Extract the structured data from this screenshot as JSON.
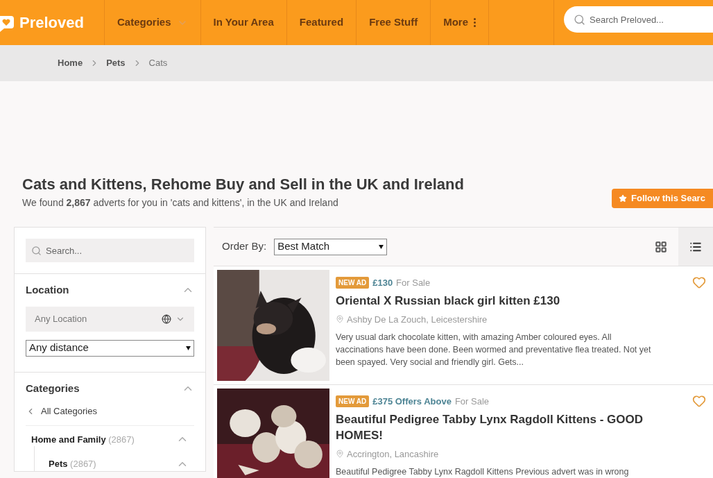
{
  "header": {
    "logo": "Preloved",
    "nav": [
      {
        "label": "Categories",
        "kind": "dropdown"
      },
      {
        "label": "In Your Area",
        "kind": "link"
      },
      {
        "label": "Featured",
        "kind": "link"
      },
      {
        "label": "Free Stuff",
        "kind": "link"
      },
      {
        "label": "More",
        "kind": "more"
      }
    ],
    "search": {
      "placeholder": "Search Preloved..."
    }
  },
  "breadcrumb": [
    {
      "label": "Home",
      "current": false
    },
    {
      "label": "Pets",
      "current": false
    },
    {
      "label": "Cats",
      "current": true
    }
  ],
  "heading": {
    "title": "Cats and Kittens, Rehome Buy and Sell in the UK and Ireland",
    "summary": "We found **2,867** adverts for you in 'cats and kittens', in the UK and Ireland",
    "follow_button": "Follow this Searc"
  },
  "sidebar": {
    "search": {
      "placeholder": "Search..."
    },
    "location": {
      "title": "Location",
      "expanded": true,
      "location_placeholder": "Any Location",
      "distance": "Any distance"
    },
    "categories": {
      "title": "Categories",
      "expanded": true,
      "back": "All Categories",
      "items": [
        {
          "label": "Home and Family",
          "count": "(2867)",
          "expanded": true,
          "children": [
            {
              "label": "Pets",
              "count": "(2867)",
              "expanded": true
            }
          ]
        }
      ]
    }
  },
  "results": {
    "order_label": "Order By:",
    "order_value": "Best Match",
    "views": [
      {
        "kind": "grid",
        "selected": false
      },
      {
        "kind": "list",
        "selected": true
      }
    ],
    "ads": [
      {
        "badge": "NEW AD",
        "price": "£130",
        "type": "For Sale",
        "title": "Oriental X Russian black girl kitten £130",
        "location": "Ashby De La Zouch, Leicestershire",
        "description": "Very usual dark chocolate kitten, with amazing Amber coloured eyes. All vaccinations have been done. Been wormed and preventative flea treated. Not yet been spayed. Very social and friendly girl. Gets...",
        "favourite": false
      },
      {
        "badge": "NEW AD",
        "price": "£375 Offers Above",
        "type": "For Sale",
        "title": "Beautiful Pedigree Tabby Lynx Ragdoll Kittens - GOOD HOMES!",
        "location": "Accrington, Lancashire",
        "description": "Beautiful Pedigree Tabby Lynx Ragdoll Kittens Previous advert was in wrong",
        "favourite": false
      }
    ]
  }
}
